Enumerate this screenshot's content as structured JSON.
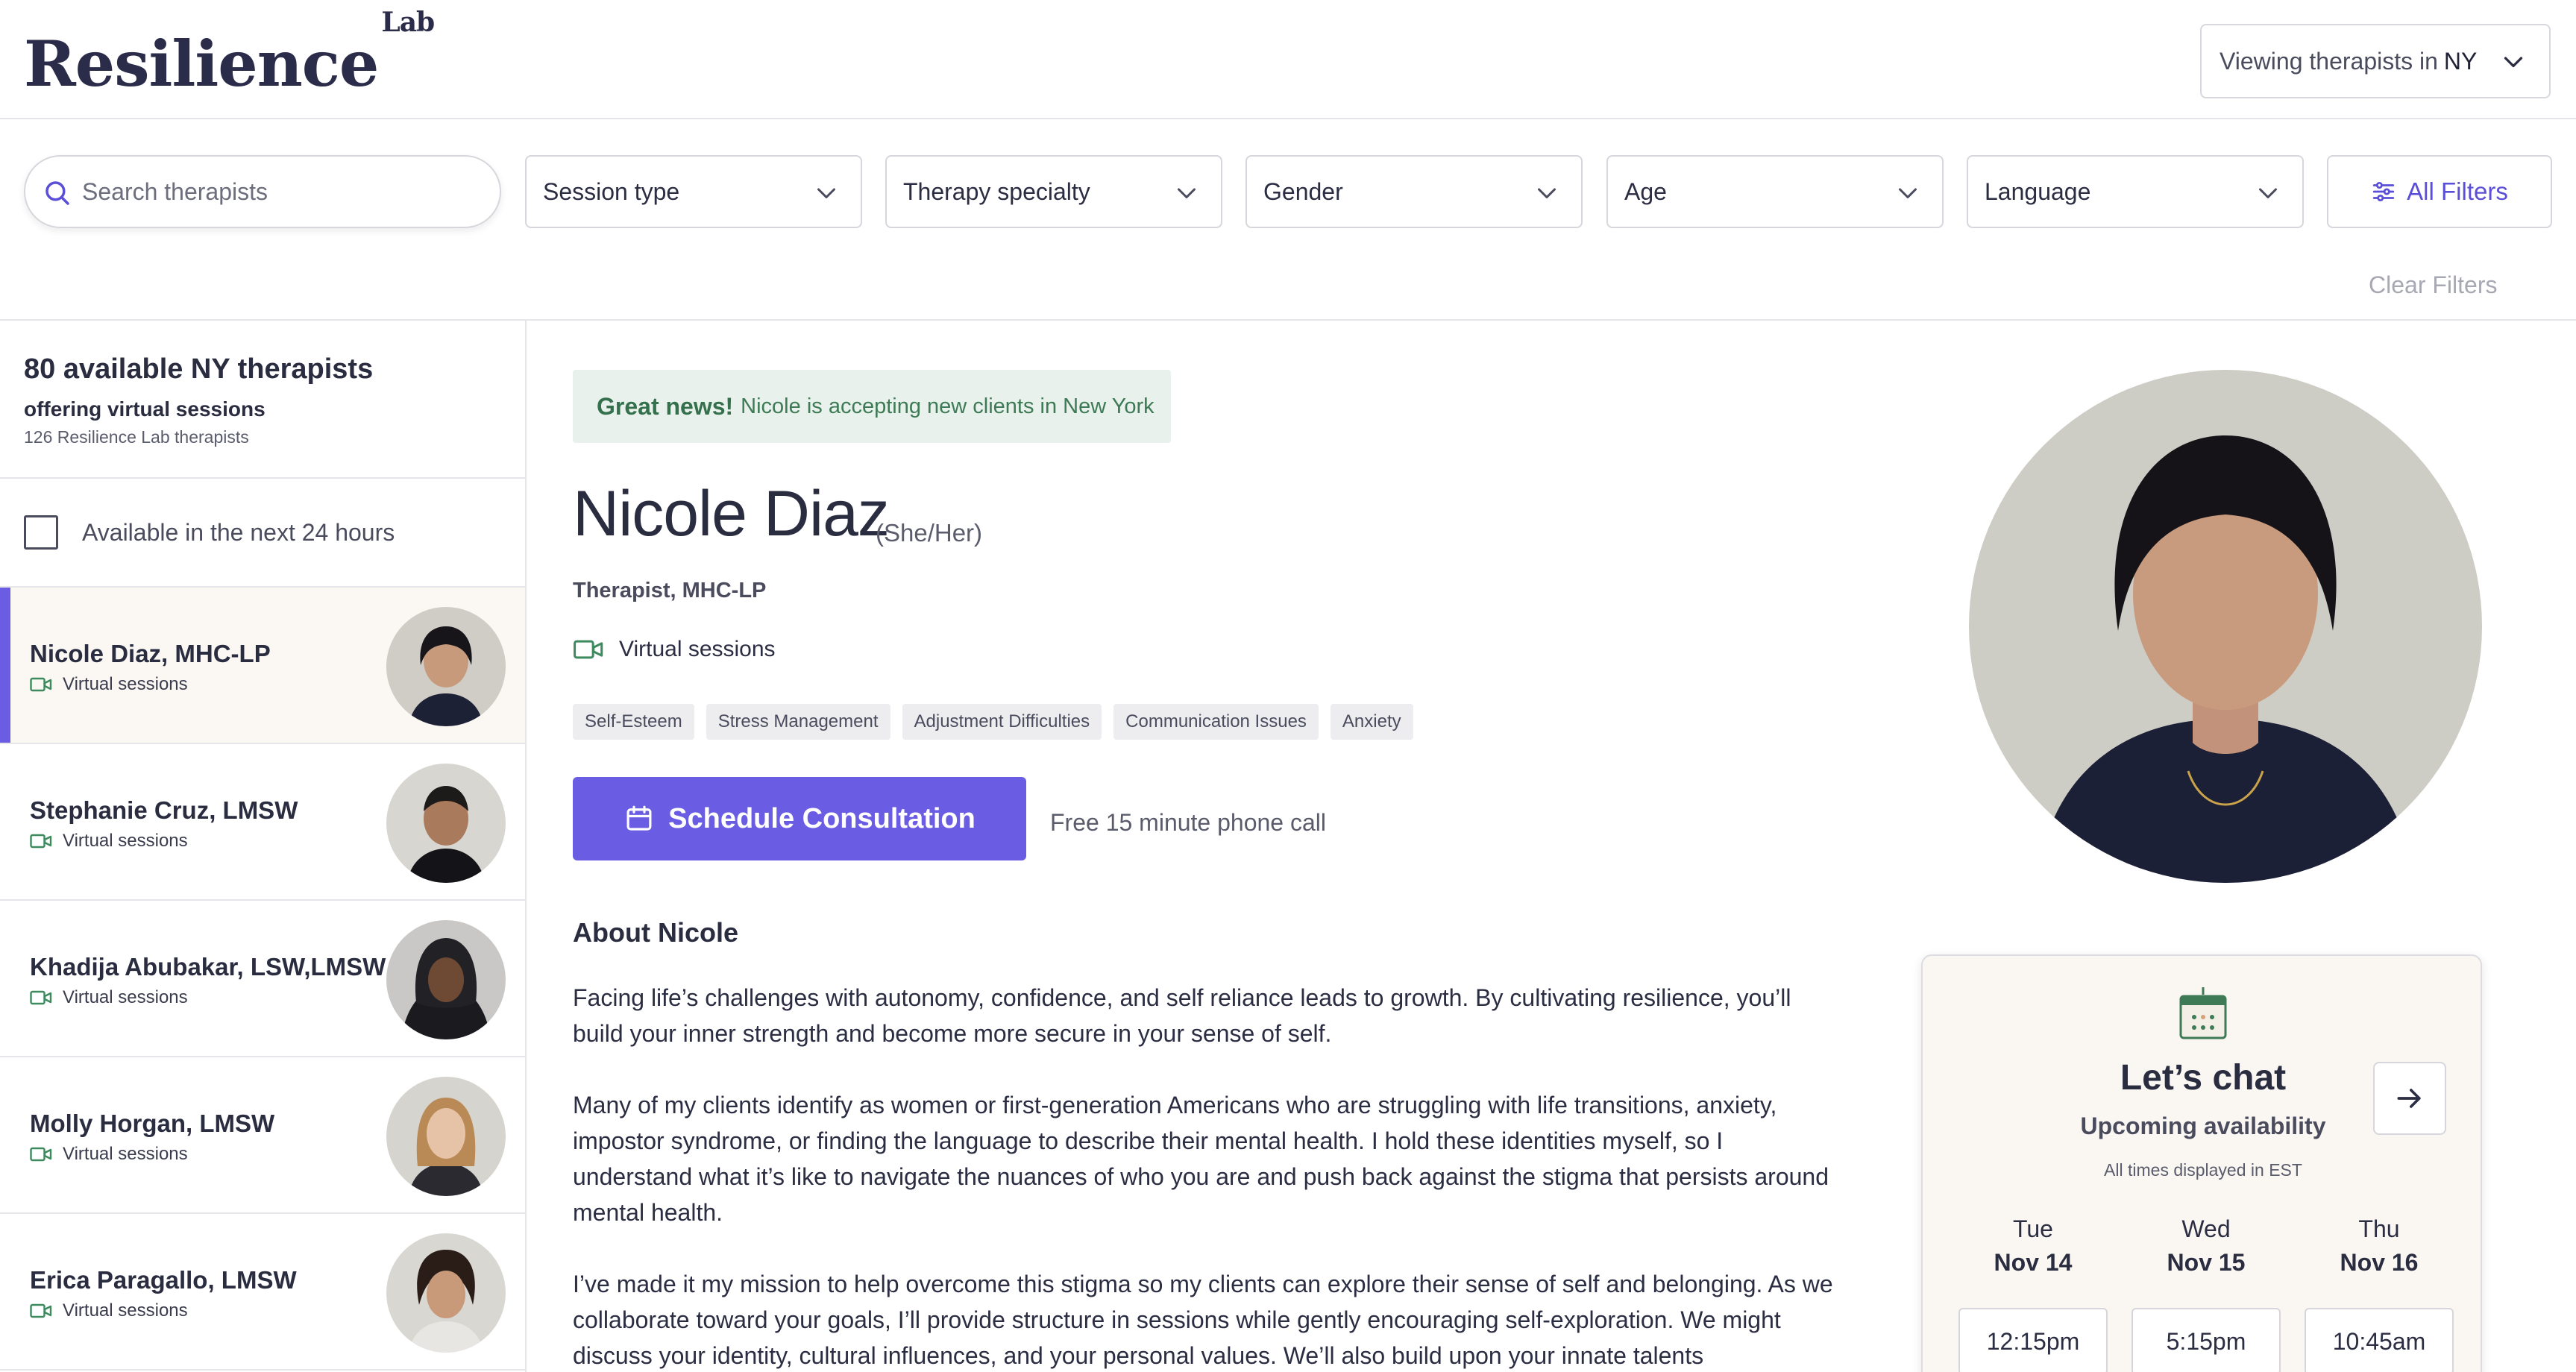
{
  "header": {
    "logo_main": "Resilience",
    "logo_sup": "Lab",
    "region_prefix": "Viewing therapists in",
    "region_value": "NY"
  },
  "filters": {
    "search_placeholder": "Search therapists",
    "dropdowns": [
      {
        "label": "Session type"
      },
      {
        "label": "Therapy specialty"
      },
      {
        "label": "Gender"
      },
      {
        "label": "Age"
      },
      {
        "label": "Language"
      }
    ],
    "all_filters": "All Filters",
    "clear_filters": "Clear Filters"
  },
  "sidebar": {
    "count_title": "80 available NY therapists",
    "count_sub": "offering virtual sessions",
    "count_total": "126 Resilience Lab therapists",
    "availability_label": "Available in the next 24 hours",
    "therapists": [
      {
        "name": "Nicole Diaz, MHC-LP",
        "mode": "Virtual sessions"
      },
      {
        "name": "Stephanie Cruz, LMSW",
        "mode": "Virtual sessions"
      },
      {
        "name": "Khadija Abubakar, LSW,LMSW",
        "mode": "Virtual sessions"
      },
      {
        "name": "Molly Horgan, LMSW",
        "mode": "Virtual sessions"
      },
      {
        "name": "Erica Paragallo, LMSW",
        "mode": "Virtual sessions"
      }
    ]
  },
  "profile": {
    "news_bold": "Great news!",
    "news_text": "Nicole is accepting new clients in New York",
    "name": "Nicole Diaz",
    "pronouns": "(She/Her)",
    "title": "Therapist, MHC-LP",
    "mode": "Virtual sessions",
    "tags": [
      "Self-Esteem",
      "Stress Management",
      "Adjustment Difficulties",
      "Communication Issues",
      "Anxiety"
    ],
    "schedule_label": "Schedule Consultation",
    "free_call": "Free 15 minute phone call",
    "about_heading": "About Nicole",
    "paragraphs": [
      "Facing life’s challenges with autonomy, confidence, and self reliance leads to growth. By cultivating resilience, you’ll build your inner strength and become more secure in your sense of self.",
      "Many of my clients identify as women or first-generation Americans who are struggling with life transitions, anxiety, impostor syndrome, or finding the language to describe their mental health. I hold these identities myself, so I understand what it’s like to navigate the nuances of who you are and push back against the stigma that persists around mental health.",
      "I’ve made it my mission to help overcome this stigma so my clients can explore their sense of self and belonging. As we collaborate toward your goals, I’ll provide structure in sessions while gently encouraging self-exploration. We might discuss your identity, cultural influences, and your personal values. We’ll also build upon your innate talents"
    ]
  },
  "chat": {
    "title": "Let’s chat",
    "subtitle": "Upcoming availability",
    "timezone": "All times displayed in EST",
    "days": [
      {
        "weekday": "Tue",
        "date": "Nov 14",
        "slot": "12:15pm"
      },
      {
        "weekday": "Wed",
        "date": "Nov 15",
        "slot": "5:15pm"
      },
      {
        "weekday": "Thu",
        "date": "Nov 16",
        "slot": "10:45am"
      }
    ]
  },
  "colors": {
    "accent": "#6b5de3",
    "news_bg": "#e9f1ec",
    "news_text": "#3d7a55",
    "video_icon": "#3d8a5e"
  }
}
